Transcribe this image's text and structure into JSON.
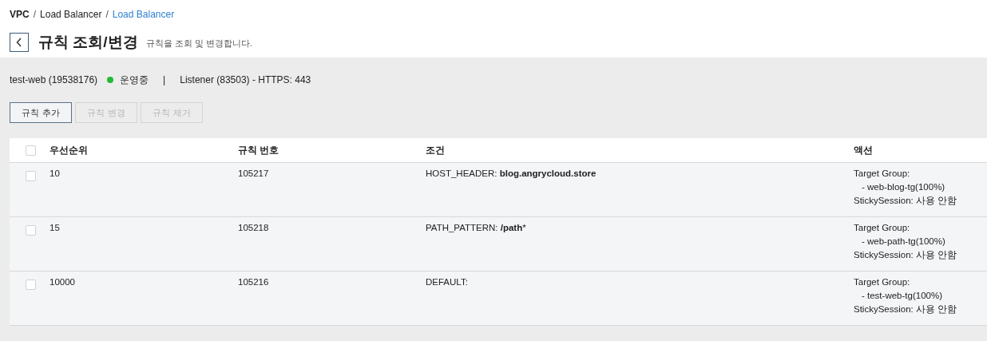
{
  "breadcrumb": [
    {
      "label": "VPC",
      "kind": "root",
      "separator": "/"
    },
    {
      "label": "Load Balancer",
      "kind": "link",
      "separator": "/"
    },
    {
      "label": "Load Balancer",
      "kind": "current"
    }
  ],
  "header": {
    "title": "규칙 조회/변경",
    "subtitle": "규칙을 조회 및 변경합니다."
  },
  "summary": {
    "load_balancer": "test-web (19538176)",
    "status": {
      "label": "운영중",
      "color": "#22bb33"
    },
    "separator": "|",
    "listener": "Listener (83503) - HTTPS: 443"
  },
  "buttons": [
    {
      "label": "규칙 추가",
      "disabled": false
    },
    {
      "label": "규칙 변경",
      "disabled": true
    },
    {
      "label": "규칙 제거",
      "disabled": true
    }
  ],
  "table": {
    "select_all_checked": false,
    "columns": [
      "우선순위",
      "규칙 번호",
      "조건",
      "액션"
    ],
    "rows": [
      {
        "checked": false,
        "priority": "10",
        "rule_number": "105217",
        "condition": "HOST_HEADER: **blog.angrycloud.store**",
        "action": [
          "Target Group:",
          "- web-blog-tg(100%)",
          "StickySession: 사용 안함"
        ]
      },
      {
        "checked": false,
        "priority": "15",
        "rule_number": "105218",
        "condition": "PATH_PATTERN: **/path***",
        "action": [
          "Target Group:",
          "- web-path-tg(100%)",
          "StickySession: 사용 안함"
        ]
      },
      {
        "checked": false,
        "priority": "10000",
        "rule_number": "105216",
        "condition": "DEFAULT:",
        "action": [
          "Target Group:",
          "- test-web-tg(100%)",
          "StickySession: 사용 안함"
        ]
      }
    ]
  }
}
